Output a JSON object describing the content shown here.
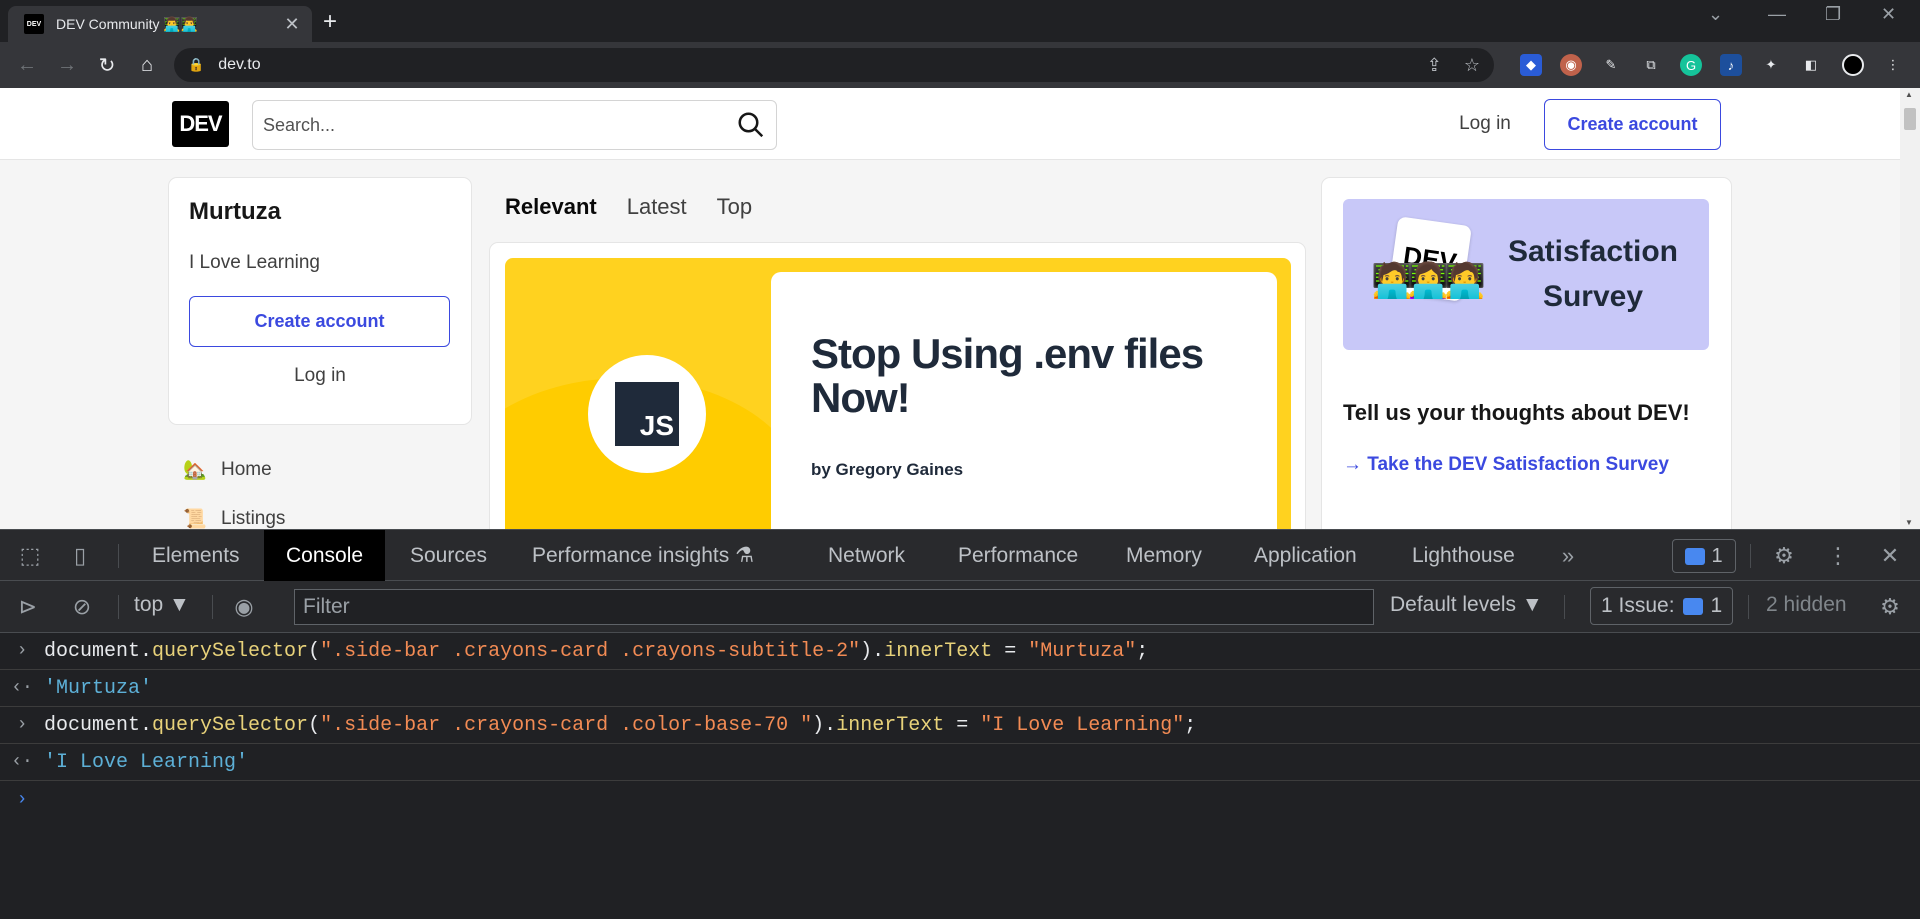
{
  "browser": {
    "tab_title": "DEV Community 👨‍💻👨‍💻",
    "favicon_text": "DEV",
    "url": "dev.to"
  },
  "header": {
    "logo": "DEV",
    "search_placeholder": "Search...",
    "login": "Log in",
    "create_account": "Create account"
  },
  "sidebar_card": {
    "title": "Murtuza",
    "subtitle": "I Love Learning",
    "create_account": "Create account",
    "login": "Log in"
  },
  "sidebar_nav": [
    {
      "emoji": "🏡",
      "label": "Home"
    },
    {
      "emoji": "📜",
      "label": "Listings"
    }
  ],
  "feed_tabs": [
    "Relevant",
    "Latest",
    "Top"
  ],
  "article": {
    "badge": "JS",
    "title": "Stop Using .env files Now!",
    "author": "by Gregory Gaines"
  },
  "survey": {
    "card_text": "DEV",
    "banner_line1": "Satisfaction",
    "banner_line2": "Survey",
    "question": "Tell us your thoughts about DEV!",
    "link": "→ Take the DEV Satisfaction Survey"
  },
  "devtools": {
    "tabs": [
      "Elements",
      "Console",
      "Sources",
      "Performance insights",
      "Network",
      "Performance",
      "Memory",
      "Application",
      "Lighthouse"
    ],
    "active_tab": "Console",
    "issues_count": "1",
    "context": "top",
    "filter_placeholder": "Filter",
    "levels": "Default levels",
    "issue_label": "1 Issue:",
    "issue_badge_count": "1",
    "hidden": "2 hidden"
  },
  "console": {
    "line1": {
      "obj": "document",
      "dot1": ".",
      "fn": "querySelector",
      "open": "(",
      "arg": "\".side-bar .crayons-card .crayons-subtitle-2\"",
      "close": ").",
      "prop": "innerText",
      "eq": " = ",
      "val": "\"Murtuza\"",
      "semi": ";"
    },
    "result1": "'Murtuza'",
    "line2": {
      "obj": "document",
      "dot1": ".",
      "fn": "querySelector",
      "open": "(",
      "arg": "\".side-bar .crayons-card .color-base-70 \"",
      "close": ").",
      "prop": "innerText",
      "eq": " = ",
      "val": "\"I Love Learning\"",
      "semi": ";"
    },
    "result2": "'I Love Learning'"
  },
  "colors": {
    "dev_primary": "#3b49df",
    "cover_yellow": "#ffd21f",
    "survey_bg": "#c8c8f8",
    "devtools_bg": "#202124"
  }
}
